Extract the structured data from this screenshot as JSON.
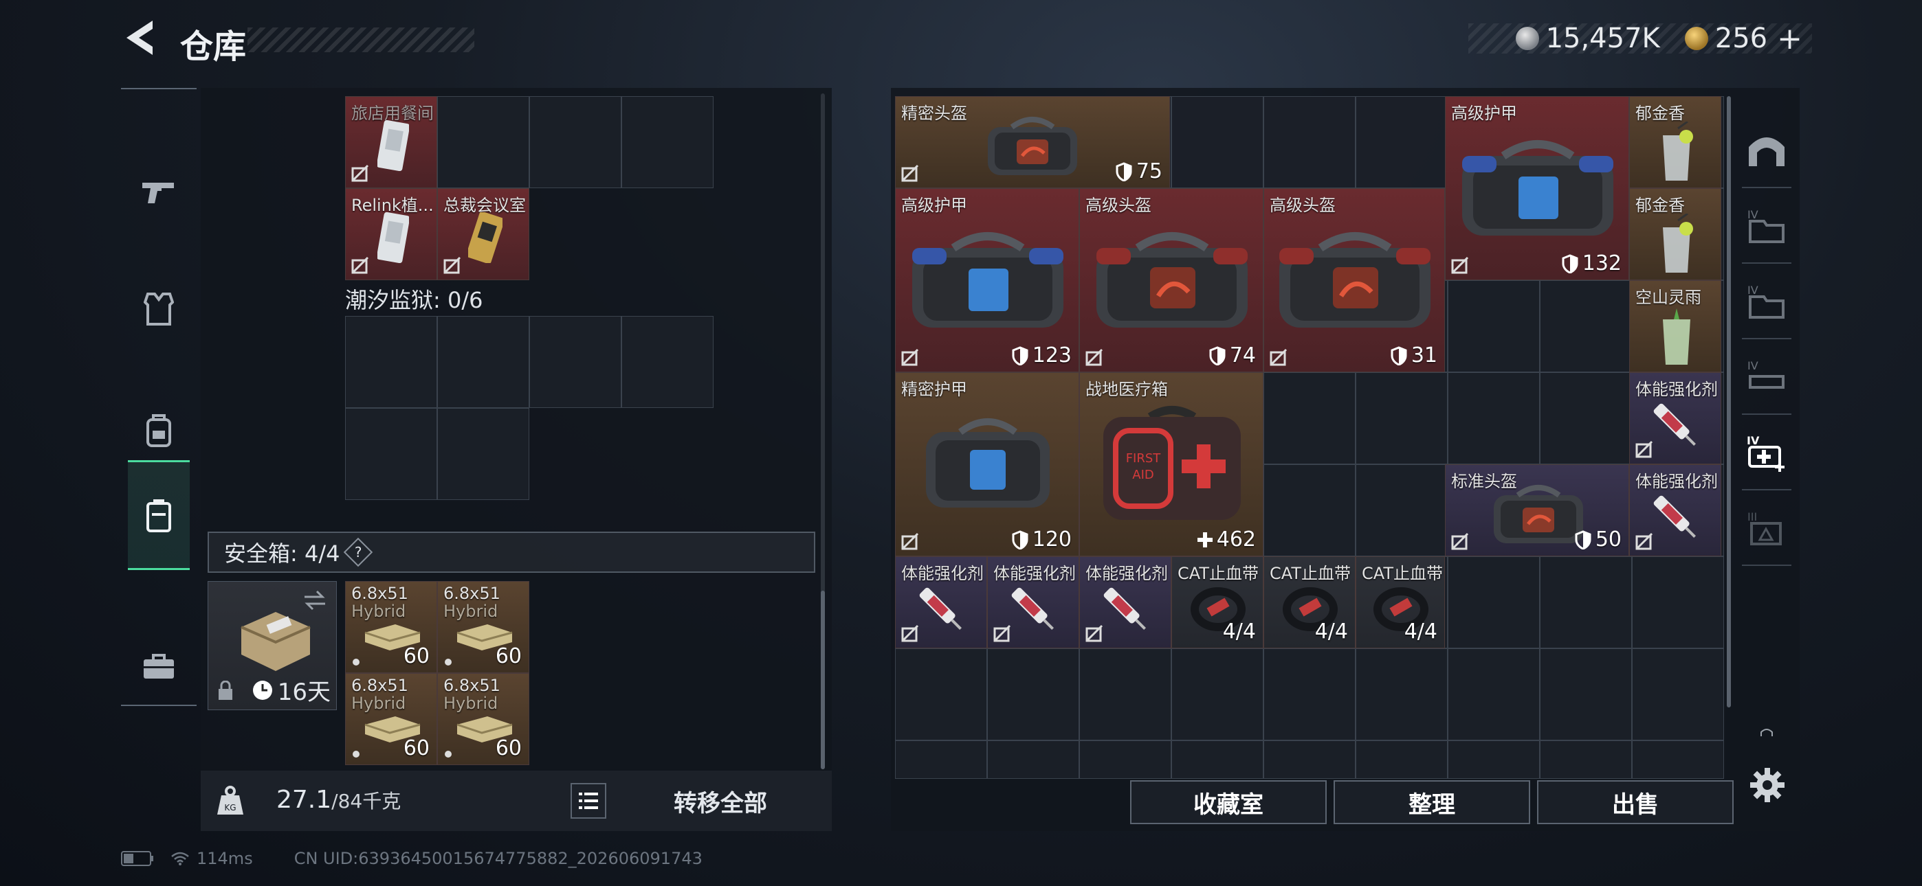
{
  "header": {
    "title": "仓库"
  },
  "currency": {
    "silver": "15,457K",
    "gold": "256"
  },
  "left_nav": [
    "pistol-icon",
    "vest-icon",
    "backpack-icon",
    "container-icon",
    "toolbox-icon"
  ],
  "pocket": {
    "items": [
      {
        "name": "旅店用餐间"
      },
      {
        "name": "Relink植..."
      },
      {
        "name": "总裁会议室"
      }
    ]
  },
  "prison": {
    "label": "潮汐监狱: 0/6"
  },
  "safebox": {
    "label": "安全箱: 4/4",
    "help": "?",
    "duration": "16天",
    "ammo": [
      {
        "name": "6.8x51",
        "sub": "Hybrid",
        "count": "60"
      },
      {
        "name": "6.8x51",
        "sub": "Hybrid",
        "count": "60"
      },
      {
        "name": "6.8x51",
        "sub": "Hybrid",
        "count": "60"
      },
      {
        "name": "6.8x51",
        "sub": "Hybrid",
        "count": "60"
      }
    ]
  },
  "weight": {
    "current": "27.1",
    "max": "/84千克"
  },
  "transfer_all": "转移全部",
  "stash": {
    "items": [
      {
        "name": "精密头盔",
        "value": "75"
      },
      {
        "name": "高级护甲",
        "value": "132"
      },
      {
        "name": "郁金香"
      },
      {
        "name": "高级护甲",
        "value": "123"
      },
      {
        "name": "高级头盔",
        "value": "74"
      },
      {
        "name": "高级头盔",
        "value": "31"
      },
      {
        "name": "郁金香"
      },
      {
        "name": "空山灵雨"
      },
      {
        "name": "精密护甲",
        "value": "120"
      },
      {
        "name": "战地医疗箱",
        "value": "462"
      },
      {
        "name": "体能强化剂"
      },
      {
        "name": "标准头盔",
        "value": "50"
      },
      {
        "name": "体能强化剂"
      },
      {
        "name": "体能强化剂"
      },
      {
        "name": "体能强化剂"
      },
      {
        "name": "体能强化剂"
      },
      {
        "name": "CAT止血带",
        "value": "4/4"
      },
      {
        "name": "CAT止血带",
        "value": "4/4"
      },
      {
        "name": "CAT止血带",
        "value": "4/4"
      }
    ]
  },
  "actions": {
    "collection": "收藏室",
    "sort": "整理",
    "sell": "出售"
  },
  "status": {
    "ping": "114ms",
    "uid": "CN UID:6393645001567477588​2_202606091743"
  }
}
